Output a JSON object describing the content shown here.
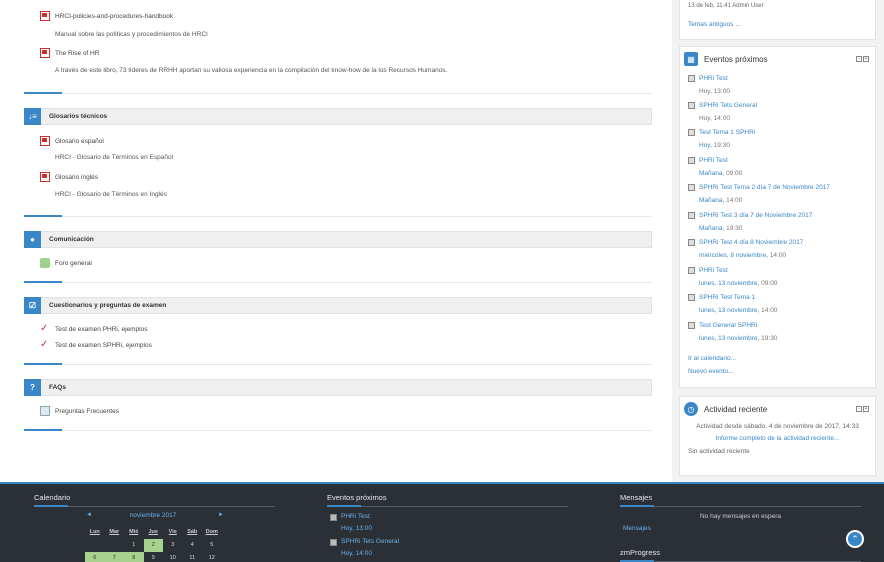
{
  "main": {
    "resources_top": [
      {
        "name": "HRCI-policies-and-procedures-handbook",
        "desc": "Manual sobre las políticas y procedimientos de HRCI"
      },
      {
        "name": "The Rise of HR",
        "desc": "A través de este libro, 73 líderes de RRHH aportan su valiosa experiencia en la compilación del know-how de la los Recursos Humanos."
      }
    ],
    "sections": [
      {
        "title": "Glosarios técnicos",
        "icon": "sort-icon",
        "glyph": "↓≡"
      },
      {
        "title": "Comunicación",
        "icon": "users-icon",
        "glyph": "👥"
      },
      {
        "title": "Cuestionarios y preguntas de examen",
        "icon": "checkbox-icon",
        "glyph": "☑"
      },
      {
        "title": "FAQs",
        "icon": "question-icon",
        "glyph": "?"
      }
    ],
    "glosarios": [
      {
        "name": "Glosario español",
        "desc": "HRCI - Glosario de Términos en Español"
      },
      {
        "name": "Glosario inglés",
        "desc": "HRCI - Glosario de Términos en Inglés"
      }
    ],
    "comunicacion": [
      {
        "name": "Foro general"
      }
    ],
    "cuestionarios": [
      {
        "name": "Test de examen PHRi, ejemplos"
      },
      {
        "name": "Test de examen SPHRi, ejemplos"
      }
    ],
    "faqs": [
      {
        "name": "Preguntas Frecuentes"
      }
    ]
  },
  "sidebar": {
    "news": {
      "meta": "13 de feb, 11:41  Admin User",
      "link": "Temas antiguos ..."
    },
    "upcoming": {
      "title": "Eventos próximos",
      "events": [
        {
          "name": "PHRi Test",
          "date": "Hoy, 13:00",
          "date_link": ""
        },
        {
          "name": "SPHRi Tets General",
          "date": "Hoy, 14:00",
          "date_link": ""
        },
        {
          "name": "Test Tema 1 SPHRi",
          "date_link": "Hoy",
          "date": ", 19:30"
        },
        {
          "name": "PHRi Test",
          "date_link": "Mañana",
          "date": ", 09:00"
        },
        {
          "name": "SPHRi Test Tema 2 día 7 de Noviembre 2017",
          "date_link": "Mañana",
          "date": ", 14:00"
        },
        {
          "name": "SPHRi Test 3 día 7 de Noviembre 2017",
          "date_link": "Mañana",
          "date": ", 19:30"
        },
        {
          "name": "SPHRi Test 4 día 8 Noviembre 2017",
          "date_link": "miércoles, 8 noviembre",
          "date": ", 14:00"
        },
        {
          "name": "PHRi Test",
          "date_link": "lunes, 13 noviembre",
          "date": ", 09:00"
        },
        {
          "name": "SPHRi Test Tema 1",
          "date_link": "lunes, 13 noviembre",
          "date": ", 14:00"
        },
        {
          "name": "Test General SPHRi",
          "date_link": "lunes, 13 noviembre",
          "date": ", 19:30"
        }
      ],
      "goto_calendar": "Ir al calendario...",
      "new_event": "Nuevo evento..."
    },
    "activity": {
      "title": "Actividad reciente",
      "since": "Actividad desde sábado, 4 de noviembre de 2017, 14:33",
      "report_link": "Informe completo de la actividad reciente...",
      "none": "Sin actividad reciente"
    }
  },
  "footer": {
    "calendar": {
      "title": "Calendario",
      "month": "noviembre 2017",
      "prev": "◄",
      "next": "►",
      "days": [
        "Lun",
        "Mar",
        "Mié",
        "Jue",
        "Vie",
        "Sáb",
        "Dom"
      ],
      "weeks": [
        [
          "",
          "",
          "1",
          "2",
          "3",
          "4",
          "5"
        ],
        [
          "6",
          "7",
          "8",
          "9",
          "10",
          "11",
          "12"
        ]
      ]
    },
    "upcoming": {
      "title": "Eventos próximos",
      "events": [
        {
          "name": "PHRi Test",
          "date": "Hoy, 13:00"
        },
        {
          "name": "SPHRi Tets General",
          "date": "Hoy, 14:00"
        }
      ]
    },
    "messages": {
      "title": "Mensajes",
      "empty": "No hay mensajes en espera",
      "link": "Mensajes"
    },
    "progress": {
      "title": "zmProgress"
    }
  },
  "colors": {
    "accent": "#3a87c8",
    "footer_bg": "#2b3037",
    "highlight": "#a9d18e"
  }
}
